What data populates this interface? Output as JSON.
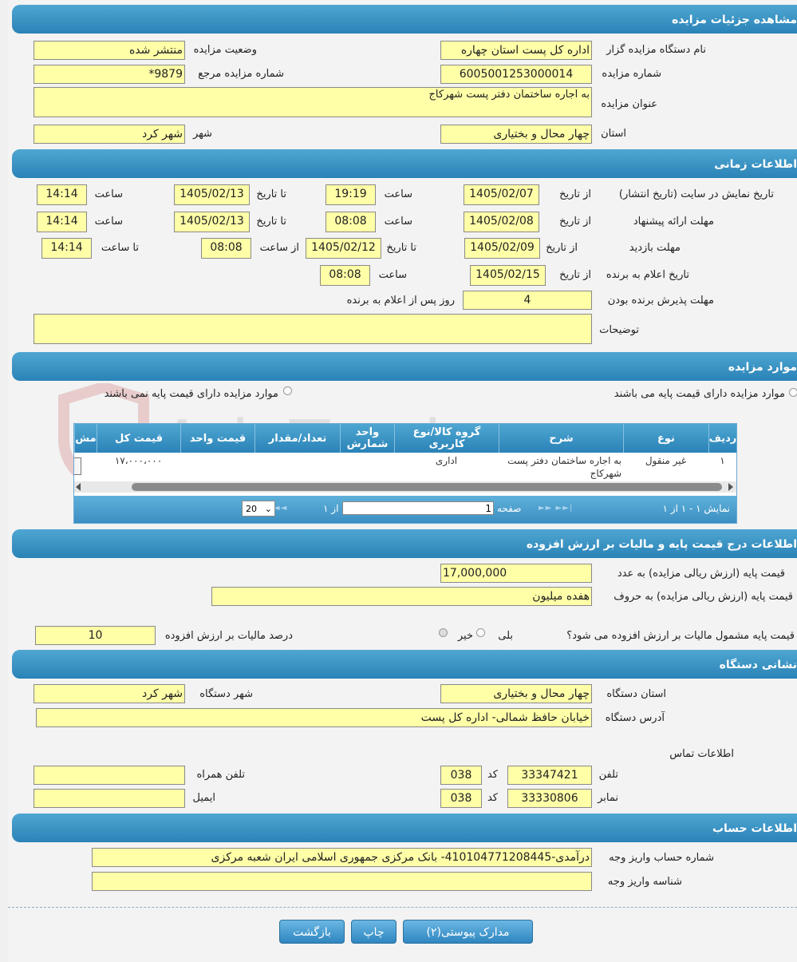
{
  "sections": {
    "details": "مشاهده جزئیات مزایده",
    "timing": "اطلاعات زمانی",
    "items": "موارد مزایده",
    "pricing": "اطلاعات درج قیمت پایه و مالیات بر ارزش افزوده",
    "address": "نشانی دستگاه",
    "account": "اطلاعات حساب"
  },
  "details": {
    "org_label": "نام دستگاه مزایده گزار",
    "org_value": "اداره کل پست استان چهاره",
    "status_label": "وضعیت مزایده",
    "status_value": "منتشر شده",
    "number_label": "شماره مزایده",
    "number_value": "6005001253000014",
    "ref_label": "شماره مزایده مرجع",
    "ref_value": "9879*",
    "title_label": "عنوان مزایده",
    "title_value": "به اجاره ساختمان دفتر پست شهرکاج",
    "province_label": "استان",
    "province_value": "چهار محال و بختیاری",
    "city_label": "شهر",
    "city_value": "شهر کرد"
  },
  "timing": {
    "display_label": "تاریخ نمایش در سایت (تاریخ انتشار)",
    "offer_label": "مهلت ارائه پیشنهاد",
    "visit_label": "مهلت بازدید",
    "announce_label": "تاریخ اعلام به برنده",
    "accept_label": "مهلت پذیرش برنده بودن",
    "notes_label": "توضیحات",
    "from_date": "از تاریخ",
    "to_date": "تا تاریخ",
    "hour": "ساعت",
    "from_hour": "از ساعت",
    "to_hour": "تا ساعت",
    "days_after": "روز پس از اعلام به برنده",
    "display_from": "1405/02/07",
    "display_from_time": "19:19",
    "display_to": "1405/02/13",
    "display_to_time": "14:14",
    "offer_from": "1405/02/08",
    "offer_from_time": "08:08",
    "offer_to": "1405/02/13",
    "offer_to_time": "14:14",
    "visit_from": "1405/02/09",
    "visit_to": "1405/02/12",
    "visit_from_time": "08:08",
    "visit_to_time": "14:14",
    "announce_from": "1405/02/15",
    "announce_time": "08:08",
    "accept_days": "4",
    "notes_value": ""
  },
  "items": {
    "radio_has_base": "موارد مزایده دارای قیمت پایه می باشند",
    "radio_no_base": "موارد مزایده دارای قیمت پایه نمی باشند",
    "columns": [
      "ردیف",
      "نوع",
      "شرح",
      "گروه کالا/نوع کاربری",
      "واحد شمارش",
      "تعداد/مقدار",
      "قیمت واحد",
      "قیمت کل",
      "مش"
    ],
    "row": {
      "index": "۱",
      "type": "غیر منقول",
      "desc": "به اجاره ساختمان دفتر پست شهرکاج",
      "group": "اداری",
      "unit": "",
      "qty": "",
      "unit_price": "",
      "total": "۱۷،۰۰۰،۰۰۰"
    },
    "pager": {
      "showing": "نمایش ۱ - ۱ از ۱",
      "page_label": "صفحه",
      "page_value": "1",
      "of_label": "از ۱",
      "page_size": "20"
    }
  },
  "pricing": {
    "base_num_label": "قیمت پایه (ارزش ریالی مزایده) به عدد",
    "base_num_value": "17,000,000",
    "base_text_label": "قیمت پایه (ارزش ریالی مزایده) به حروف",
    "base_text_value": "هفده میلیون",
    "vat_question": "قیمت پایه مشمول مالیات بر ارزش افزوده می شود؟",
    "yes": "بلی",
    "no": "خیر",
    "vat_percent_label": "درصد مالیات بر ارزش افزوده",
    "vat_percent_value": "10"
  },
  "address": {
    "province_label": "استان دستگاه",
    "province_value": "چهار محال و بختیاری",
    "city_label": "شهر دستگاه",
    "city_value": "شهر کرد",
    "addr_label": "آدرس دستگاه",
    "addr_value": "خیابان حافظ شمالی- اداره کل پست",
    "contact_label": "اطلاعات تماس",
    "phone_label": "تلفن",
    "phone_value": "33347421",
    "code_label": "کد",
    "phone_code": "038",
    "mobile_label": "تلفن همراه",
    "mobile_value": "",
    "fax_label": "نمابر",
    "fax_value": "33330806",
    "fax_code": "038",
    "email_label": "ایمیل",
    "email_value": ""
  },
  "account": {
    "acct_label": "شماره حساب واریز وجه",
    "acct_value": "درآمدی-410104771208445- بانک مرکزی جمهوری اسلامی ایران شعبه مرکزی",
    "id_label": "شناسه واریز وجه",
    "id_value": ""
  },
  "buttons": {
    "attachments": "مدارک پیوستی(۲)",
    "print": "چاپ",
    "back": "بازگشت"
  },
  "watermark": "AriaTender.neT"
}
